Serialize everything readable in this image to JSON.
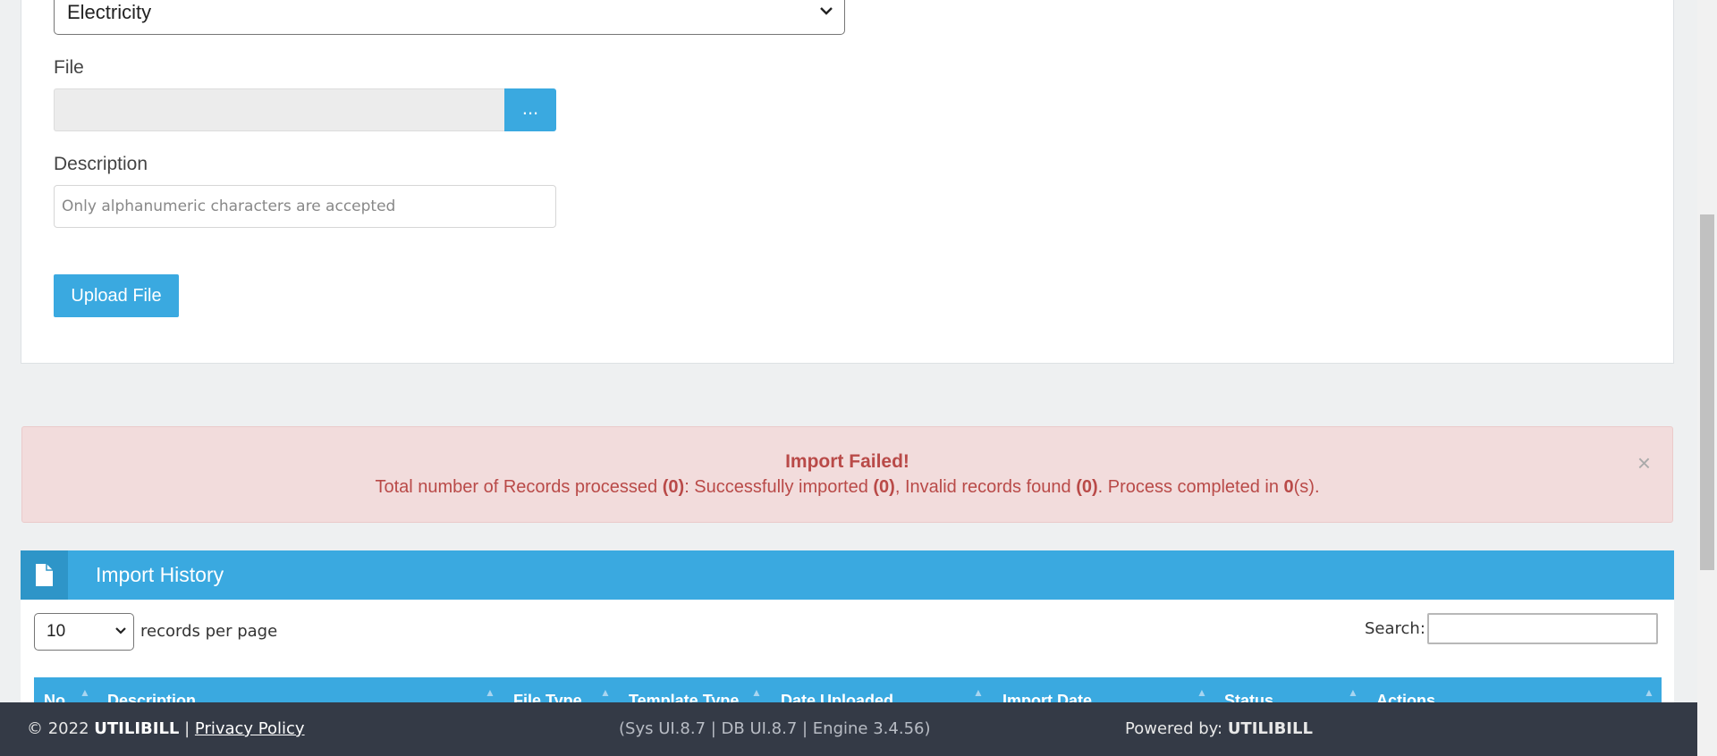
{
  "form": {
    "type_select_value": "Electricity",
    "file_label": "File",
    "browse_label": "...",
    "description_label": "Description",
    "description_placeholder": "Only alphanumeric characters are accepted",
    "upload_label": "Upload File"
  },
  "alert": {
    "title": "Import Failed!",
    "msg_1": "Total number of Records processed ",
    "total": "(0)",
    "msg_2": ": Successfully imported ",
    "imported": "(0)",
    "msg_3": ", Invalid records found ",
    "invalid": "(0)",
    "msg_4": ". Process completed in ",
    "seconds": "0",
    "msg_5": "(s).",
    "close": "×"
  },
  "history": {
    "title": "Import History",
    "page_length": "10",
    "records_per_page": "records per page",
    "search_label": "Search:",
    "columns": [
      "No.",
      "Description",
      "File Type",
      "Template Type",
      "Date Uploaded",
      "Import Date",
      "Status",
      "Actions"
    ]
  },
  "footer": {
    "copyright": "© 2022 ",
    "brand": "UTILIBILL",
    "sep": " | ",
    "privacy": "Privacy Policy",
    "version": "(Sys UI.8.7 | DB UI.8.7 | Engine 3.4.56)",
    "powered_by": "Powered by: ",
    "powered_brand": "UTILIBILL"
  },
  "colors": {
    "accent": "#3aa9e0",
    "alert_bg": "#f2dcdc",
    "alert_text": "#b94a48",
    "footer_bg": "#343a46"
  }
}
